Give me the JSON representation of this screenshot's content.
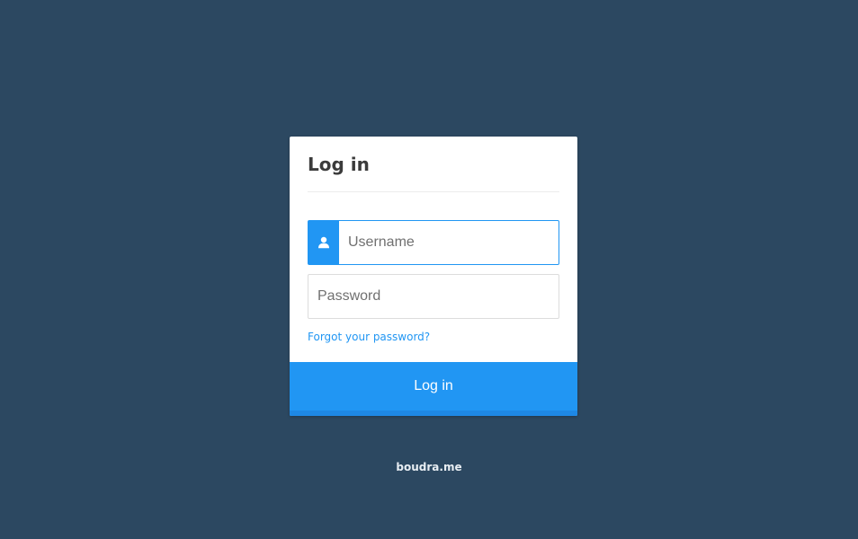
{
  "login": {
    "title": "Log in",
    "username": {
      "placeholder": "Username",
      "value": "",
      "icon": "user-icon"
    },
    "password": {
      "placeholder": "Password",
      "value": ""
    },
    "forgot_link": "Forgot your password?",
    "submit_label": "Log in"
  },
  "footer": {
    "text": "boudra.me"
  },
  "colors": {
    "background": "#2c4861",
    "accent": "#2196f3",
    "card": "#ffffff"
  }
}
